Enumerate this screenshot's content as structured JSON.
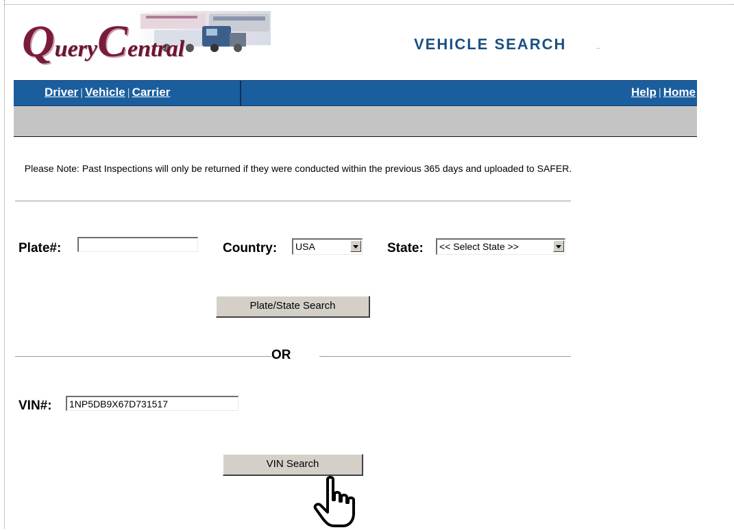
{
  "logo": {
    "q": "Q",
    "uery": "uery",
    "c": "C",
    "entral": "entral"
  },
  "page": {
    "title": "VEHICLE SEARCH"
  },
  "nav": {
    "left": [
      "Driver",
      "Vehicle",
      "Carrier"
    ],
    "right": [
      "Help",
      "Home"
    ],
    "separator": "|"
  },
  "note": "Please Note:  Past Inspections will only be returned if they were conducted within the previous 365 days and uploaded to SAFER.",
  "plate": {
    "label": "Plate#:",
    "value": "",
    "country_label": "Country:",
    "country_value": "USA",
    "state_label": "State:",
    "state_value": "<< Select State >>",
    "button": "Plate/State Search"
  },
  "or_text": "OR",
  "vin": {
    "label": "VIN#:",
    "value": "1NP5DB9X67D731517",
    "button": "VIN Search"
  },
  "colors": {
    "nav_bg": "#1a5e9e",
    "title": "#1a4f82",
    "logo": "#7a1b3a",
    "gray_bar": "#c4c4c4"
  },
  "icons": [
    "truck-logo-icon",
    "hand-pointer-cursor-icon",
    "dropdown-arrow-icon"
  ]
}
